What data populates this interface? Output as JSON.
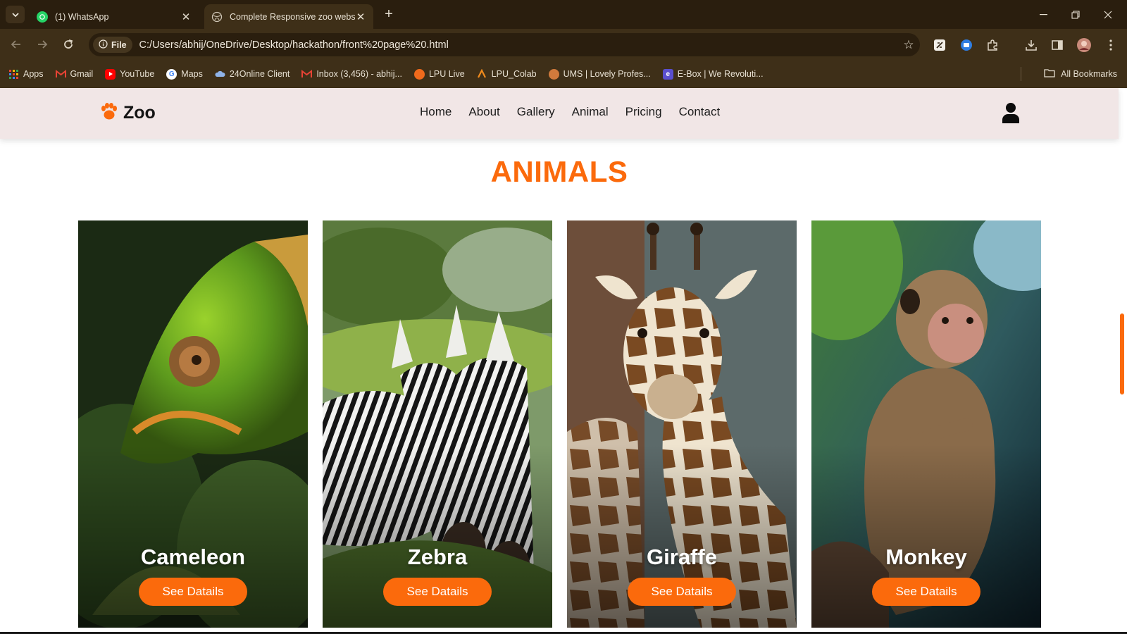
{
  "browser": {
    "tabs": [
      {
        "title": "(1) WhatsApp",
        "icon": "whatsapp-icon",
        "active": false
      },
      {
        "title": "Complete Responsive zoo webs",
        "icon": "globe-icon",
        "active": true
      }
    ],
    "address": {
      "scheme_chip": "File",
      "url": "C:/Users/abhij/OneDrive/Desktop/hackathon/front%20page%20.html"
    },
    "bookmarks": [
      {
        "label": "Apps",
        "icon": "apps-grid-icon",
        "color": "#4285f4"
      },
      {
        "label": "Gmail",
        "icon": "gmail-icon",
        "color": "#ea4335"
      },
      {
        "label": "YouTube",
        "icon": "youtube-icon",
        "color": "#ff0000"
      },
      {
        "label": "Maps",
        "icon": "google-icon",
        "color": "#4285f4"
      },
      {
        "label": "24Online Client",
        "icon": "cloud-icon",
        "color": "#8fb3e8"
      },
      {
        "label": "Inbox (3,456) - abhij...",
        "icon": "gmail-icon",
        "color": "#ea4335"
      },
      {
        "label": "LPU Live",
        "icon": "lpu-live-icon",
        "color": "#f06a1c"
      },
      {
        "label": "LPU_Colab",
        "icon": "lpu-colab-icon",
        "color": "#f08a1c"
      },
      {
        "label": "UMS | Lovely Profes...",
        "icon": "ums-icon",
        "color": "#d07a3c"
      },
      {
        "label": "E-Box | We Revoluti...",
        "icon": "ebox-icon",
        "color": "#5a4fcf"
      }
    ],
    "all_bookmarks": "All Bookmarks"
  },
  "site": {
    "brand": "Zoo",
    "brand_icon": "paw-icon",
    "nav": [
      "Home",
      "About",
      "Gallery",
      "Animal",
      "Pricing",
      "Contact"
    ],
    "user_icon": "user-icon",
    "section_title": "ANIMALS",
    "accent": "#fb6a0c",
    "animals": [
      {
        "name": "Cameleon",
        "button": "See Datails"
      },
      {
        "name": "Zebra",
        "button": "See Datails"
      },
      {
        "name": "Giraffe",
        "button": "See Datails"
      },
      {
        "name": "Monkey",
        "button": "See Datails"
      }
    ]
  }
}
